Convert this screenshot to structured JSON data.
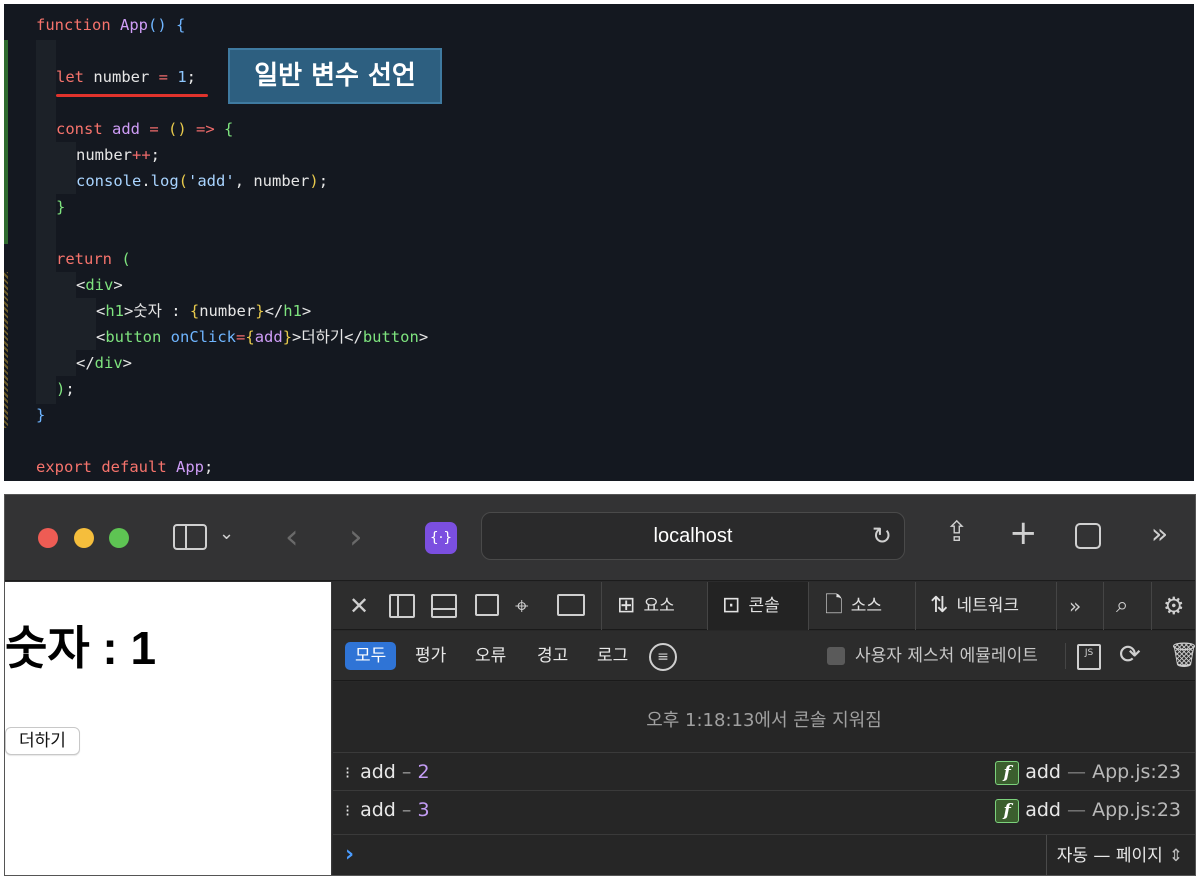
{
  "editor": {
    "lines": [
      {
        "tokens": [
          {
            "c": "tk-kw",
            "t": "function "
          },
          {
            "c": "tk-fn",
            "t": "App"
          },
          {
            "c": "tk-br",
            "t": "() {"
          }
        ]
      },
      {
        "tokens": []
      },
      {
        "tokens": [
          {
            "c": "tk-kw",
            "t": "let "
          },
          {
            "c": "tk-pl",
            "t": "number "
          },
          {
            "c": "tk-op",
            "t": "= "
          },
          {
            "c": "tk-num",
            "t": "1"
          },
          {
            "c": "tk-pl",
            "t": ";"
          }
        ]
      },
      {
        "tokens": []
      },
      {
        "tokens": [
          {
            "c": "tk-kw",
            "t": "const "
          },
          {
            "c": "tk-fn",
            "t": "add "
          },
          {
            "c": "tk-op",
            "t": "= "
          },
          {
            "c": "tk-br3",
            "t": "() "
          },
          {
            "c": "tk-op",
            "t": "=> "
          },
          {
            "c": "tk-br2",
            "t": "{"
          }
        ]
      },
      {
        "tokens": [
          {
            "c": "tk-pl",
            "t": "number"
          },
          {
            "c": "tk-op",
            "t": "++"
          },
          {
            "c": "tk-pl",
            "t": ";"
          }
        ]
      },
      {
        "tokens": [
          {
            "c": "tk-var",
            "t": "console"
          },
          {
            "c": "tk-pl",
            "t": "."
          },
          {
            "c": "tk-var",
            "t": "log"
          },
          {
            "c": "tk-br3",
            "t": "("
          },
          {
            "c": "tk-str",
            "t": "'add'"
          },
          {
            "c": "tk-pl",
            "t": ", number"
          },
          {
            "c": "tk-br3",
            "t": ")"
          },
          {
            "c": "tk-pl",
            "t": ";"
          }
        ]
      },
      {
        "tokens": [
          {
            "c": "tk-br2",
            "t": "}"
          }
        ]
      },
      {
        "tokens": []
      },
      {
        "tokens": [
          {
            "c": "tk-kw",
            "t": "return "
          },
          {
            "c": "tk-br2",
            "t": "("
          }
        ]
      },
      {
        "tokens": [
          {
            "c": "tk-pl",
            "t": "<"
          },
          {
            "c": "tk-tag",
            "t": "div"
          },
          {
            "c": "tk-pl",
            "t": ">"
          }
        ]
      },
      {
        "tokens": [
          {
            "c": "tk-pl",
            "t": "<"
          },
          {
            "c": "tk-tag",
            "t": "h1"
          },
          {
            "c": "tk-pl",
            "t": ">숫자 : "
          },
          {
            "c": "tk-br3",
            "t": "{"
          },
          {
            "c": "tk-pl",
            "t": "number"
          },
          {
            "c": "tk-br3",
            "t": "}"
          },
          {
            "c": "tk-pl",
            "t": "</"
          },
          {
            "c": "tk-tag",
            "t": "h1"
          },
          {
            "c": "tk-pl",
            "t": ">"
          }
        ]
      },
      {
        "tokens": [
          {
            "c": "tk-pl",
            "t": "<"
          },
          {
            "c": "tk-tag",
            "t": "button "
          },
          {
            "c": "tk-attr",
            "t": "onClick"
          },
          {
            "c": "tk-op",
            "t": "="
          },
          {
            "c": "tk-br3",
            "t": "{"
          },
          {
            "c": "tk-fn",
            "t": "add"
          },
          {
            "c": "tk-br3",
            "t": "}"
          },
          {
            "c": "tk-pl",
            "t": ">더하기</"
          },
          {
            "c": "tk-tag",
            "t": "button"
          },
          {
            "c": "tk-pl",
            "t": ">"
          }
        ]
      },
      {
        "tokens": [
          {
            "c": "tk-pl",
            "t": "</"
          },
          {
            "c": "tk-tag",
            "t": "div"
          },
          {
            "c": "tk-pl",
            "t": ">"
          }
        ]
      },
      {
        "tokens": [
          {
            "c": "tk-br2",
            "t": ")"
          },
          {
            "c": "tk-pl",
            "t": ";"
          }
        ]
      },
      {
        "tokens": [
          {
            "c": "tk-br",
            "t": "}"
          }
        ]
      },
      {
        "tokens": []
      },
      {
        "tokens": [
          {
            "c": "tk-kw",
            "t": "export default "
          },
          {
            "c": "tk-fn",
            "t": "App"
          },
          {
            "c": "tk-pl",
            "t": ";"
          }
        ]
      }
    ],
    "annotation": "일반 변수 선언"
  },
  "browser": {
    "url": "localhost",
    "page": {
      "heading": "숫자 : 1",
      "button_label": "더하기"
    },
    "devtools": {
      "tabs": {
        "elements": "요소",
        "console": "콘솔",
        "sources": "소스",
        "network": "네트워크"
      },
      "filters": {
        "all": "모두",
        "evaluation": "평가",
        "errors": "오류",
        "warnings": "경고",
        "logs": "로그"
      },
      "gesture_emulation": "사용자 제스처 에뮬레이트",
      "cleared_message": "오후 1:18:13에서 콘솔 지워짐",
      "logs": [
        {
          "message": "add",
          "value": "2",
          "function": "add",
          "source": "App.js:23"
        },
        {
          "message": "add",
          "value": "3",
          "function": "add",
          "source": "App.js:23"
        }
      ],
      "context_select": "자동 — 페이지"
    }
  }
}
